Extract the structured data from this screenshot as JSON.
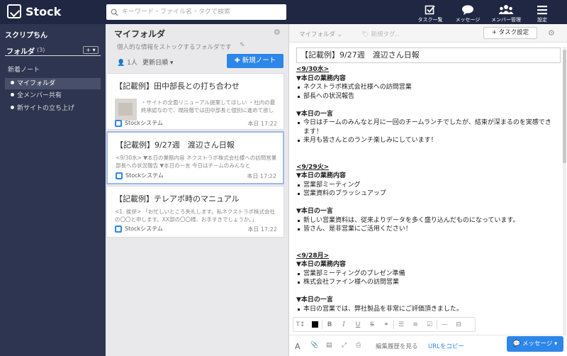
{
  "app": {
    "name": "Stock"
  },
  "search": {
    "placeholder": "キーワード・ファイル名・タグで検索"
  },
  "nav": [
    {
      "label": "タスク一覧",
      "icon": "task-check-icon"
    },
    {
      "label": "メッセージ",
      "icon": "speech-bubble-icon"
    },
    {
      "label": "メンバー管理",
      "icon": "members-icon"
    },
    {
      "label": "設定",
      "icon": "hamburger-icon"
    }
  ],
  "sidebar": {
    "user": "スクリプちん",
    "folder_heading": "フォルダ",
    "folder_count": "(3)",
    "add_label": "+ ▾",
    "new_notes": "新着ノート",
    "folders": [
      "マイフォルダ",
      "全メンバー共有",
      "新サイトの立ち上げ"
    ]
  },
  "list": {
    "title": "マイフォルダ",
    "description": "個人的な情報をストックするフォルダです",
    "members": "1人",
    "sort": "更新日順 ▾",
    "new_note": "✚ 新規ノート",
    "notes": [
      {
        "title": "【記載例】田中部長との打ち合わせ",
        "excerpt": "・サイトの全面リニューアル提案してほしい ・社内の最終承認なので、現段階では田中部長と個別に進めて欲しい ・来週末までに、事前提案書を送付して欲し",
        "author": "Stockシステム",
        "time": "本日 17:22"
      },
      {
        "title": "【記載例】9/27週　渡辺さん日報",
        "excerpt": "<9/30水> ▼本日の業務内容 ネクストラボ株式会社様への訪問営業 部長への状況報告 ▼本日の一言 今日はチームのみんなと",
        "author": "Stockシステム",
        "time": "本日 17:22"
      },
      {
        "title": "【記載例】テレアポ時のマニュアル",
        "excerpt": "<1. 挨拶> 「お忙しいところ失礼します。私ネクストラボ株式会社の〇〇と申します。XX部の〇〇様、お手すきでしょうか。」",
        "author": "Stockシステム",
        "time": "本日 17:22"
      }
    ]
  },
  "editor": {
    "folder": "マイフォルダ ⌄",
    "tag_placeholder": "新規タグ..",
    "task_button": "+ タスク設定",
    "title": "【記載例】9/27週　渡辺さん日報",
    "sections": [
      {
        "date": "<9/30水>",
        "work_heading": "▼本日の業務内容",
        "work": [
          "ネクストラボ株式会社様への訪問営業",
          "部長への状況報告"
        ],
        "comment_heading": "▼本日の一言",
        "comments": [
          "今日はチームのみんなと月に一回のチームランチでしたが、結束が深まるのを実感できます！",
          "来月も皆さんとのランチ楽しみにしています！"
        ]
      },
      {
        "date": "<9/29火>",
        "work_heading": "▼本日の業務内容",
        "work": [
          "営業部ミーティング",
          "営業資料のブラッシュアップ"
        ],
        "comment_heading": "▼本日の一言",
        "comments": [
          "新しい営業資料は、従来よりデータを多く盛り込んだものになっています。",
          "皆さん、是非営業にご活用ください！"
        ]
      },
      {
        "date": "<9/28月>",
        "work_heading": "▼本日の業務内容",
        "work": [
          "営業部ミーティングのプレゼン準備",
          "株式会社ファイン様への訪問営業"
        ],
        "comment_heading": "▼本日の一言",
        "comments": [
          "本日の営業では、弊社製品を非常にご評価頂きました。"
        ]
      }
    ],
    "bottom": {
      "history": "編集履歴を見る",
      "copy_url": "URLをコピー",
      "message": "メッセージ ▾"
    }
  }
}
